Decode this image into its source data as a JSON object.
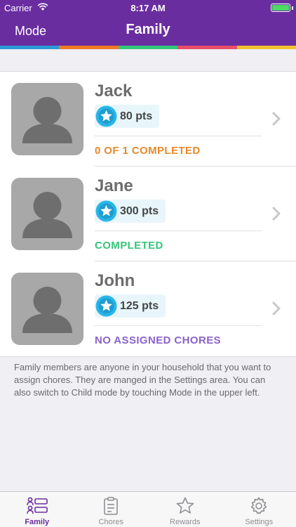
{
  "status_bar": {
    "carrier": "Carrier",
    "time": "8:17 AM"
  },
  "nav": {
    "left_label": "Mode",
    "title": "Family"
  },
  "colors": {
    "brand": "#6a2da0",
    "rainbow": [
      "#2b9bd6",
      "#f07a24",
      "#35c57a",
      "#e84e6a",
      "#f2c22e"
    ],
    "completed_partial": "#e8892a",
    "completed": "#35c57a",
    "no_assigned": "#8a63c9",
    "star": "#29b6e8"
  },
  "members": [
    {
      "name": "Jack",
      "points": "80 pts",
      "status": "0 OF 1 COMPLETED",
      "status_kind": "partial"
    },
    {
      "name": "Jane",
      "points": "300 pts",
      "status": "COMPLETED",
      "status_kind": "completed"
    },
    {
      "name": "John",
      "points": "125 pts",
      "status": "NO ASSIGNED CHORES",
      "status_kind": "none"
    }
  ],
  "footer_note": "Family members are anyone in your household that you want to assign chores. They are manged in the Settings area. You can also switch to Child mode by touching Mode in the upper left.",
  "tabs": [
    {
      "label": "Family",
      "icon": "family-icon",
      "active": true
    },
    {
      "label": "Chores",
      "icon": "clipboard-icon",
      "active": false
    },
    {
      "label": "Rewards",
      "icon": "star-icon",
      "active": false
    },
    {
      "label": "Settings",
      "icon": "gear-icon",
      "active": false
    }
  ]
}
